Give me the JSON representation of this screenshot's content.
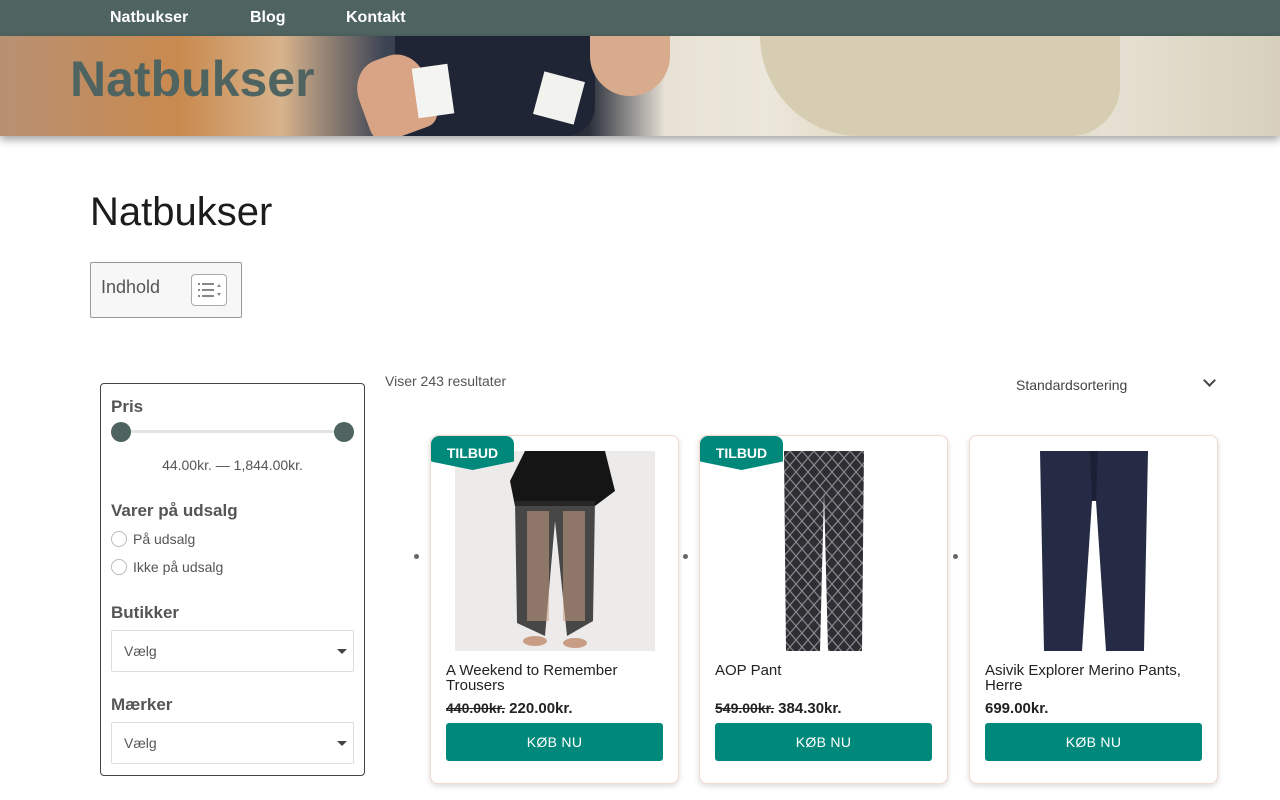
{
  "nav": {
    "items": [
      "Natbukser",
      "Blog",
      "Kontakt"
    ]
  },
  "hero": {
    "title": "Natbukser"
  },
  "page": {
    "title": "Natbukser"
  },
  "toc": {
    "label": "Indhold",
    "icon": "list-toggle-icon"
  },
  "filters": {
    "price": {
      "heading": "Pris",
      "range_text": "44.00kr. — 1,844.00kr.",
      "min": 44,
      "max": 1844,
      "selected_min": 44,
      "selected_max": 1844
    },
    "sale": {
      "heading": "Varer på udsalg",
      "options": [
        "På udsalg",
        "Ikke på udsalg"
      ]
    },
    "shops": {
      "heading": "Butikker",
      "value": "Vælg"
    },
    "brands": {
      "heading": "Mærker",
      "value": "Vælg"
    }
  },
  "results": {
    "count_text": "Viser 243 resultater",
    "sort_value": "Standardsortering"
  },
  "products": [
    {
      "badge": "TILBUD",
      "name": "A Weekend to Remember Trousers",
      "old_price": "440.00kr.",
      "price": "220.00kr.",
      "button": "KØB NU"
    },
    {
      "badge": "TILBUD",
      "name": "AOP Pant",
      "old_price": "549.00kr.",
      "price": "384.30kr.",
      "button": "KØB NU"
    },
    {
      "badge": "",
      "name": "Asivik Explorer Merino Pants, Herre",
      "old_price": "",
      "price": "699.00kr.",
      "button": "KØB NU"
    }
  ],
  "colors": {
    "nav_bg": "#4f6461",
    "accent": "#00897b"
  }
}
